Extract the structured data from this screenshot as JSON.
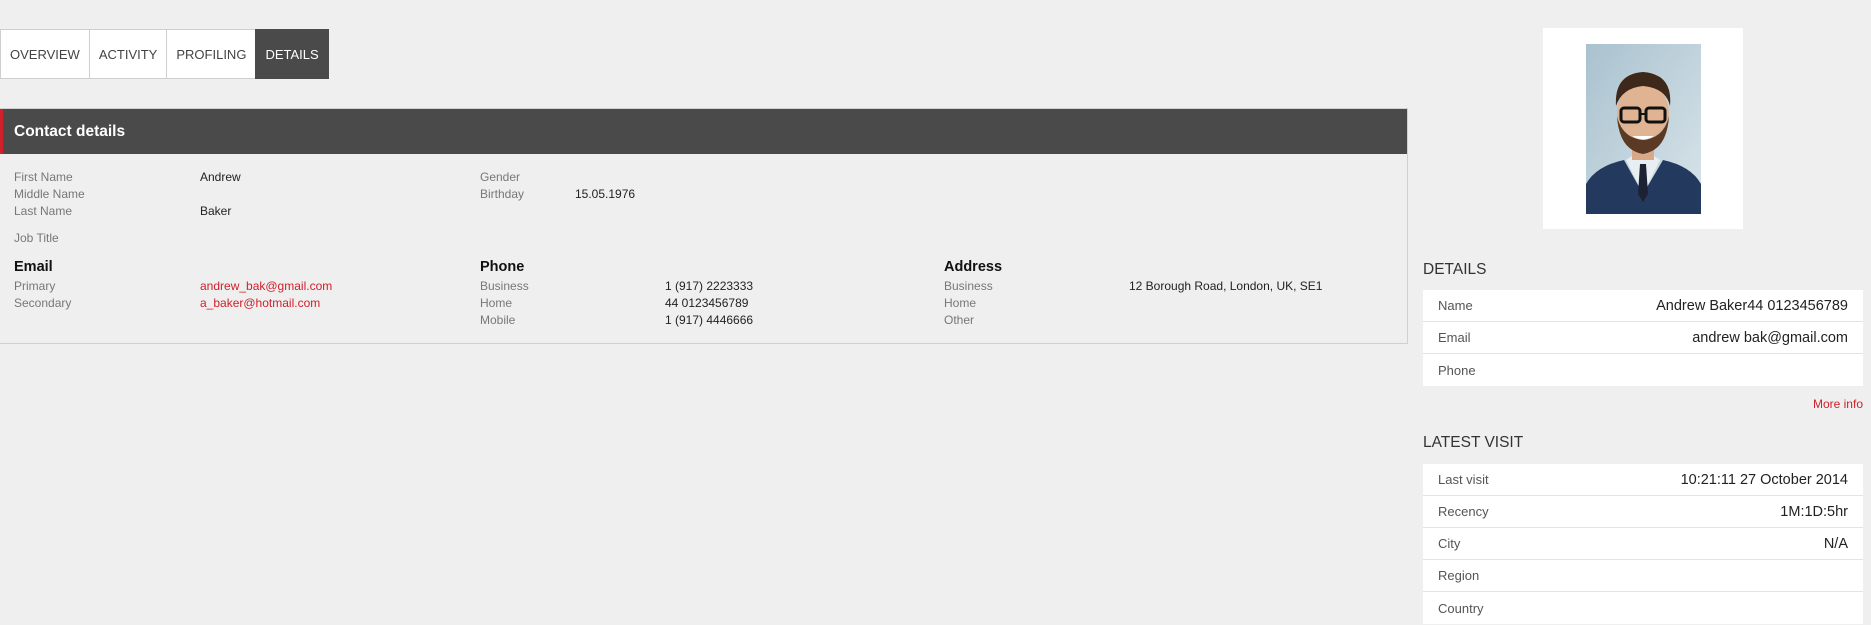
{
  "tabs": [
    "OVERVIEW",
    "ACTIVITY",
    "PROFILING",
    "DETAILS"
  ],
  "active_tab": "DETAILS",
  "contact": {
    "title": "Contact details",
    "first_name_label": "First Name",
    "first_name": "Andrew",
    "middle_name_label": "Middle Name",
    "middle_name": "",
    "last_name_label": "Last Name",
    "last_name": "Baker",
    "job_title_label": "Job Title",
    "job_title": "",
    "gender_label": "Gender",
    "gender": "",
    "birthday_label": "Birthday",
    "birthday": "15.05.1976",
    "email": {
      "heading": "Email",
      "primary_label": "Primary",
      "primary": "andrew_bak@gmail.com",
      "secondary_label": "Secondary",
      "secondary": "a_baker@hotmail.com"
    },
    "phone": {
      "heading": "Phone",
      "business_label": "Business",
      "business": "1 (917) 2223333",
      "home_label": "Home",
      "home": "44 0123456789",
      "mobile_label": "Mobile",
      "mobile": "1 (917) 4446666"
    },
    "address": {
      "heading": "Address",
      "business_label": "Business",
      "business": "12 Borough Road, London, UK, SE1",
      "home_label": "Home",
      "home": "",
      "other_label": "Other",
      "other": ""
    }
  },
  "sidebar": {
    "details_title": "DETAILS",
    "details": [
      {
        "label": "Name",
        "value": "Andrew Baker44 0123456789"
      },
      {
        "label": "Email",
        "value": "andrew  bak@gmail.com"
      },
      {
        "label": "Phone",
        "value": ""
      }
    ],
    "more_info": "More info",
    "visit_title": "LATEST VISIT",
    "visit": [
      {
        "label": "Last visit",
        "value": "10:21:11 27 October 2014"
      },
      {
        "label": "Recency",
        "value": "1M:1D:5hr"
      },
      {
        "label": "City",
        "value": "N/A"
      },
      {
        "label": "Region",
        "value": ""
      },
      {
        "label": "Country",
        "value": ""
      }
    ]
  },
  "colors": {
    "accent": "#d0202a",
    "header_bg": "#4a4a4a",
    "page_bg": "#efefef"
  }
}
